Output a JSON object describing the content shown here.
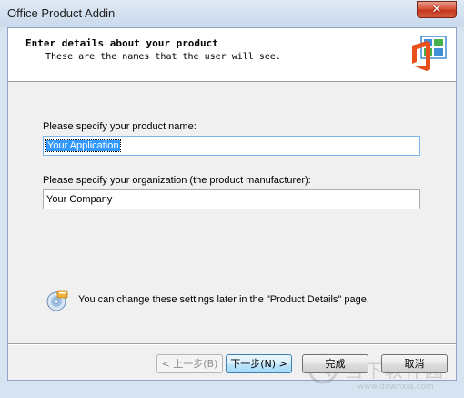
{
  "window": {
    "title": "Office Product Addin",
    "close_glyph": "✕"
  },
  "header": {
    "title": "Enter details about your product",
    "subtitle": "These are the names that the user will see.",
    "logo_icon": "office-logo-icon"
  },
  "form": {
    "product_name_label": "Please specify your product name:",
    "product_name_value": "Your Application",
    "organization_label": "Please specify your organization (the product manufacturer):",
    "organization_value": "Your Company"
  },
  "info": {
    "icon": "settings-disc-icon",
    "text": "You can change these settings later in the \"Product Details\" page."
  },
  "buttons": {
    "back": "< 上一步(B)",
    "next": "下一步(N) >",
    "finish": "完成",
    "cancel": "取消"
  },
  "watermark": {
    "text": "当下软件园",
    "url": "www.downxia.com"
  },
  "colors": {
    "selection": "#3399ff",
    "office_orange": "#e8501c",
    "close_red": "#c4381c"
  }
}
